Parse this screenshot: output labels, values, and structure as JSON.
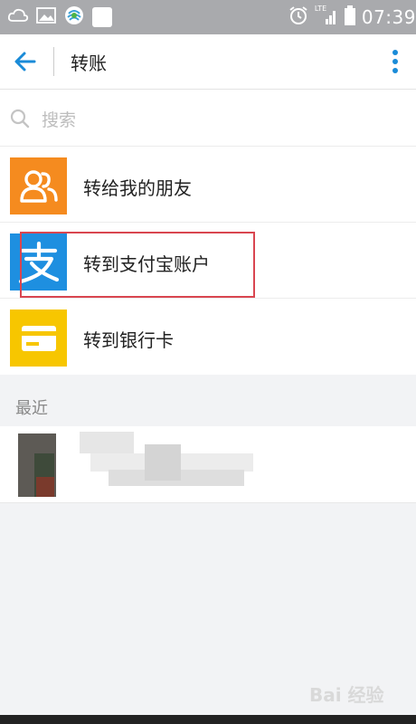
{
  "status_bar": {
    "time": "07:39",
    "network_label": "LTE",
    "icons": [
      "cloud-icon",
      "gallery-icon",
      "carrier-icon",
      "notification-icon",
      "alarm-icon",
      "signal-icon",
      "battery-icon"
    ]
  },
  "header": {
    "title": "转账",
    "back_icon": "back-arrow-icon",
    "more_icon": "more-vertical-icon"
  },
  "search": {
    "placeholder": "搜索"
  },
  "options": [
    {
      "label": "转给我的朋友",
      "icon": "friends-icon",
      "color": "#f58b1f"
    },
    {
      "label": "转到支付宝账户",
      "icon": "alipay-icon",
      "color": "#1e8fe0"
    },
    {
      "label": "转到银行卡",
      "icon": "bank-card-icon",
      "color": "#f7c600"
    }
  ],
  "recent": {
    "title": "最近"
  },
  "watermark": "Bai 经验",
  "colors": {
    "accent": "#1a8bd8",
    "highlight_box": "#d94650",
    "background": "#f2f3f5"
  }
}
